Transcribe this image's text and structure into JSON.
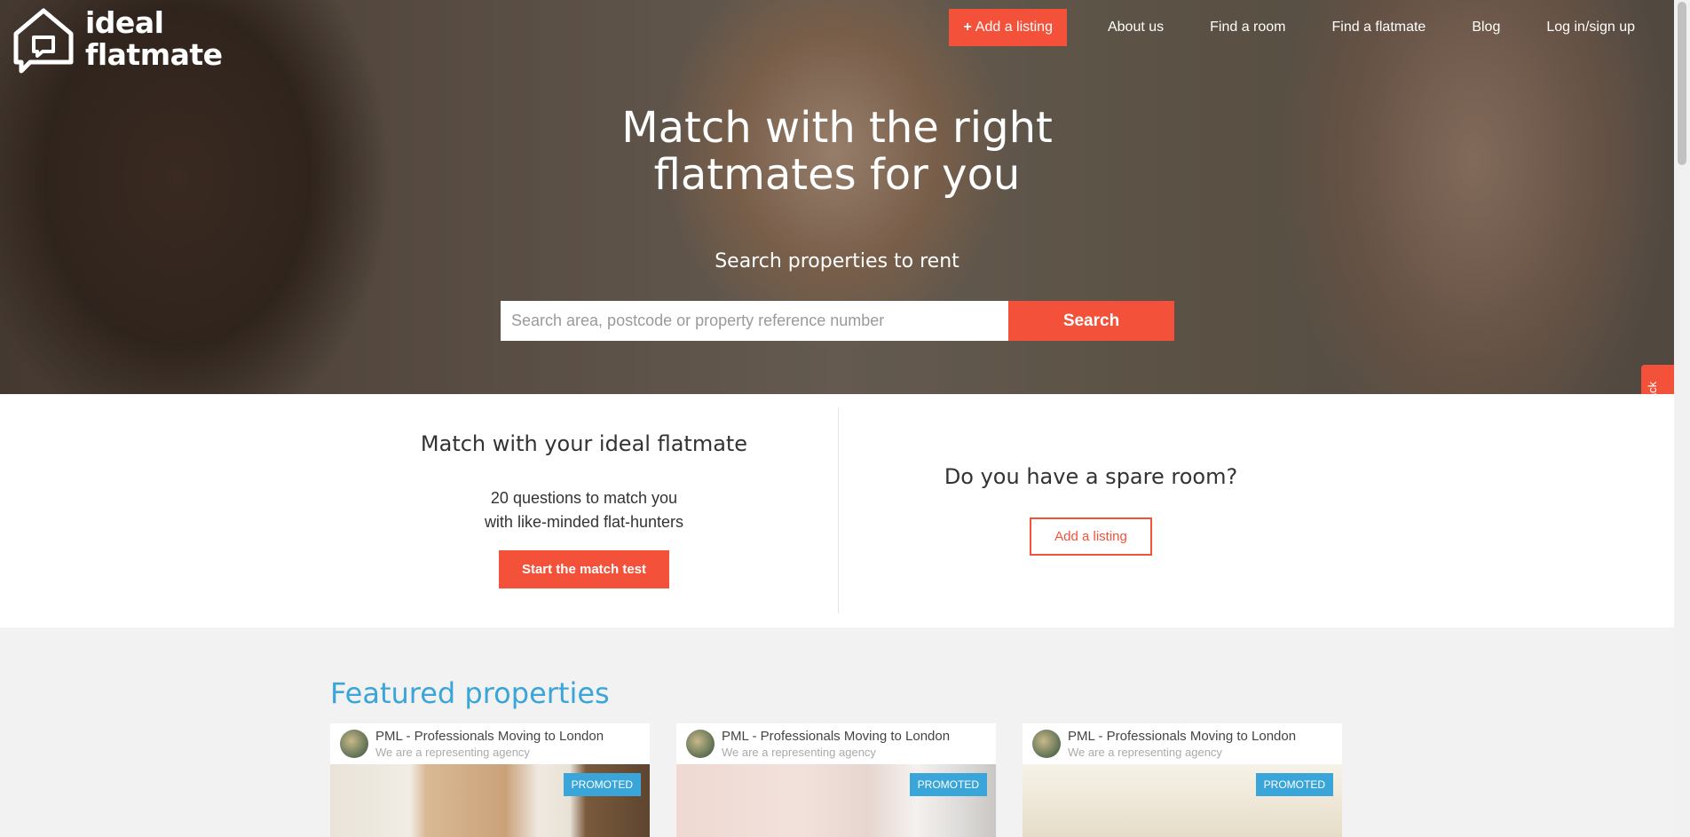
{
  "brand": {
    "line1": "ideal",
    "line2": "flatmate"
  },
  "nav": {
    "add_listing": "Add a listing",
    "items": [
      "About us",
      "Find a room",
      "Find a flatmate",
      "Blog",
      "Log in/sign up"
    ]
  },
  "hero": {
    "title_line1": "Match with the right",
    "title_line2": "flatmates for you",
    "subtitle": "Search properties to rent",
    "search_placeholder": "Search area, postcode or property reference number",
    "search_button": "Search"
  },
  "feedback": {
    "label": "Feedback"
  },
  "match": {
    "title": "Match with your ideal flatmate",
    "sub_line1": "20 questions to match you",
    "sub_line2": "with like-minded flat-hunters",
    "button": "Start the match test"
  },
  "spare": {
    "title": "Do you have a spare room?",
    "button": "Add a listing"
  },
  "featured": {
    "title": "Featured properties",
    "cards": [
      {
        "agent": "PML - Professionals Moving to London",
        "tagline": "We are a representing agency",
        "badge": "PROMOTED"
      },
      {
        "agent": "PML - Professionals Moving to London",
        "tagline": "We are a representing agency",
        "badge": "PROMOTED"
      },
      {
        "agent": "PML - Professionals Moving to London",
        "tagline": "We are a representing agency",
        "badge": "PROMOTED"
      }
    ]
  },
  "colors": {
    "accent": "#f4513a",
    "featured_blue": "#3aa5d8"
  }
}
